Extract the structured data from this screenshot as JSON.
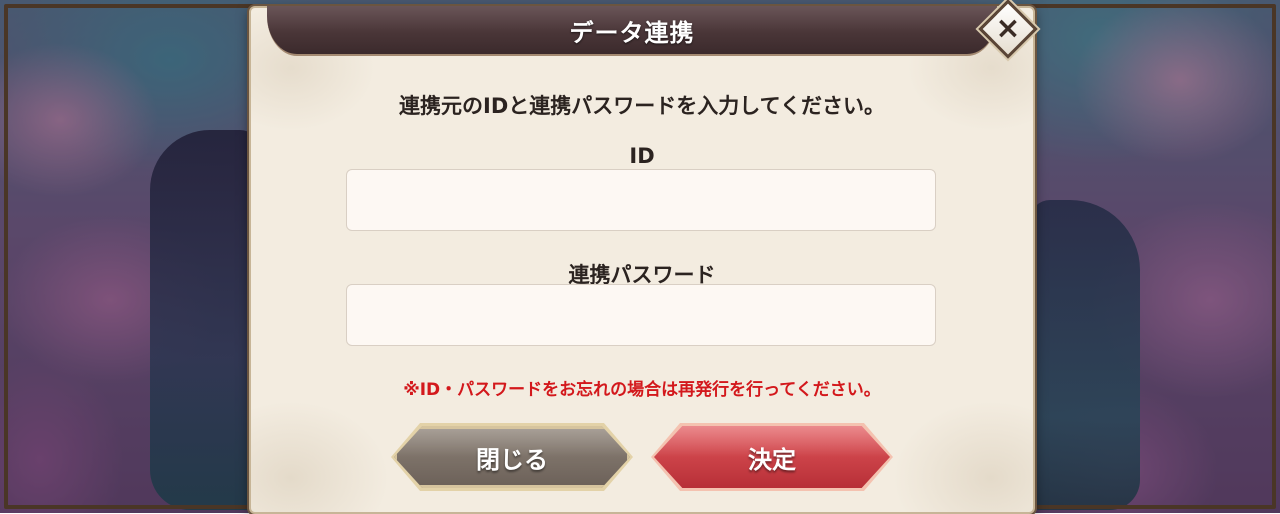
{
  "dialog": {
    "title": "データ連携",
    "close_icon": "×",
    "instruction": "連携元のIDと連携パスワードを入力してください。",
    "id_label": "ID",
    "id_value": "",
    "password_label": "連携パスワード",
    "password_value": "",
    "warning": "※ID・パスワードをお忘れの場合は再発行を行ってください。",
    "close_button": "閉じる",
    "confirm_button": "決定"
  },
  "colors": {
    "warning_text": "#d3181c",
    "confirm_button": "#c93a41",
    "close_button": "#7d7268",
    "title_bar": "#4a3638"
  },
  "icons": {
    "close": "close-icon"
  }
}
